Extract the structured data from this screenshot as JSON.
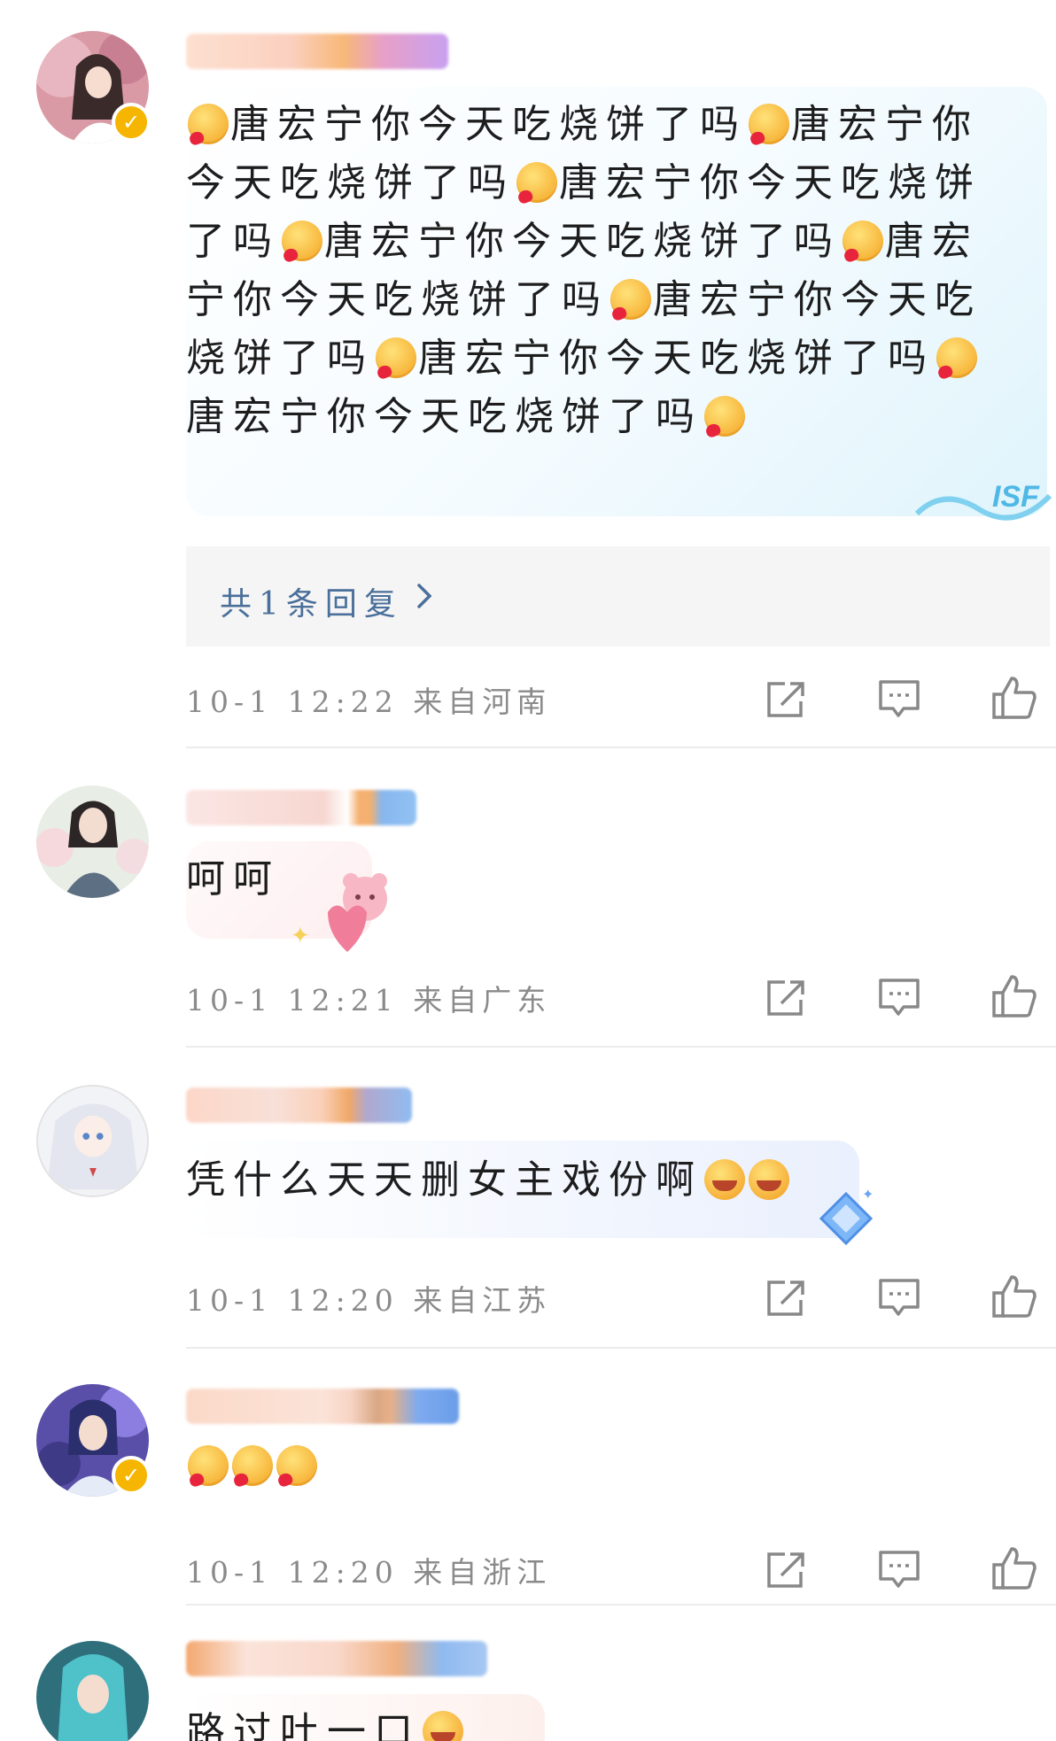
{
  "comments": [
    {
      "text_segments": [
        "唐宏宁你今天吃烧饼了吗",
        "唐宏宁你今天吃烧饼了吗",
        "唐宏宁你今天吃烧饼了吗",
        "唐宏宁你今天吃烧饼了吗",
        "唐宏宁你今天吃烧饼了吗",
        "唐宏宁你今天吃烧饼了吗",
        "唐宏宁你今天吃烧饼了吗",
        "唐宏宁你今天吃烧饼了吗"
      ],
      "reply_summary": "共1条回复",
      "time": "10-1 12:22",
      "location": "来自河南",
      "verified": true
    },
    {
      "text": "呵呵",
      "time": "10-1 12:21",
      "location": "来自广东",
      "verified": false
    },
    {
      "text": "凭什么天天删女主戏份啊",
      "time": "10-1 12:20",
      "location": "来自江苏",
      "verified": false
    },
    {
      "text": "",
      "time": "10-1 12:20",
      "location": "来自浙江",
      "verified": true
    },
    {
      "text": "路过吐一口"
    }
  ],
  "icons": {
    "share": "share-icon",
    "comment": "comment-icon",
    "like": "like-icon",
    "reply_arrow": "chevron-right-icon",
    "verified": "verified-badge-icon"
  },
  "colors": {
    "reply_link": "#4a6f9a",
    "meta_text": "#8a8a8a",
    "verified_badge": "#f6b500"
  }
}
